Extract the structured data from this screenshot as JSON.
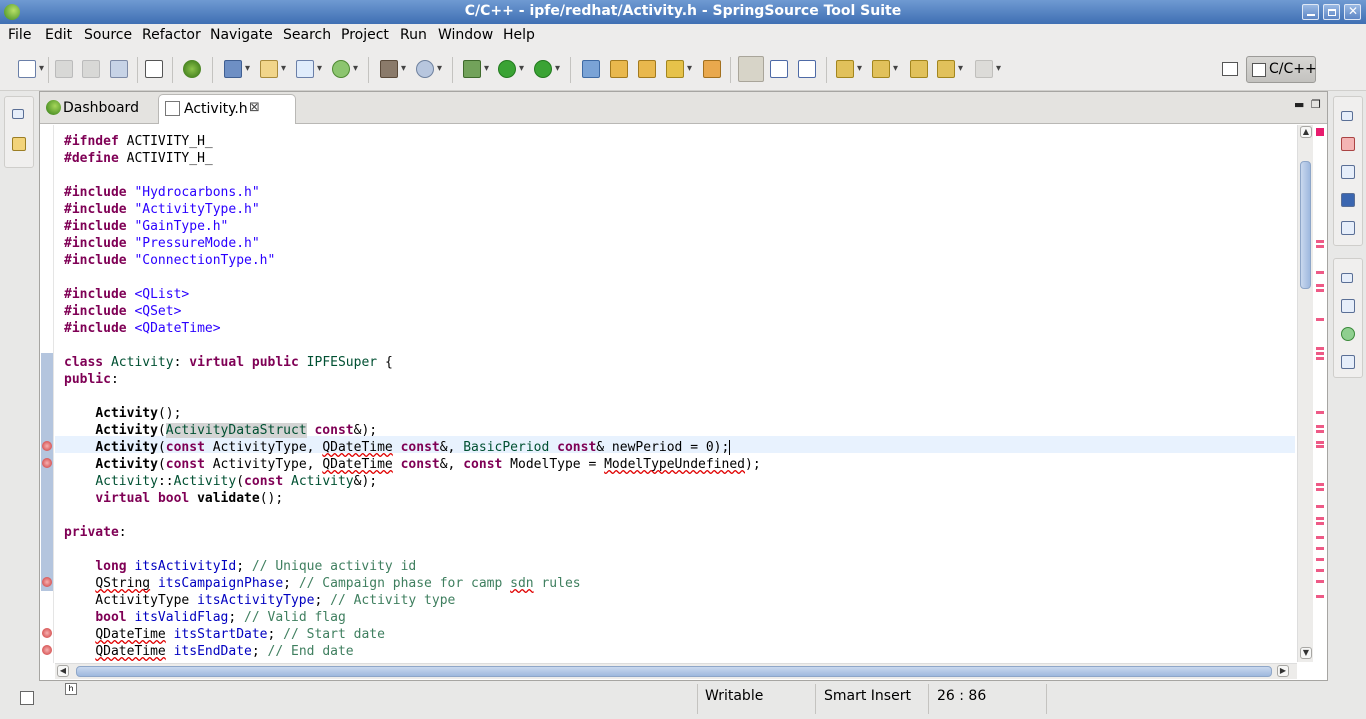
{
  "window": {
    "title": "C/C++ - ipfe/redhat/Activity.h - SpringSource Tool Suite"
  },
  "menu": [
    "File",
    "Edit",
    "Source",
    "Refactor",
    "Navigate",
    "Search",
    "Project",
    "Run",
    "Window",
    "Help"
  ],
  "perspective": {
    "label": "C/C++"
  },
  "tabs": [
    {
      "label": "Dashboard",
      "icon": "dashboard-icon",
      "active": false
    },
    {
      "label": "Activity.h",
      "icon": "header-file-icon",
      "active": true,
      "close": "⊠"
    }
  ],
  "code_lines": [
    "#ifndef ACTIVITY_H_",
    "#define ACTIVITY_H_",
    "",
    "#include \"Hydrocarbons.h\"",
    "#include \"ActivityType.h\"",
    "#include \"GainType.h\"",
    "#include \"PressureMode.h\"",
    "#include \"ConnectionType.h\"",
    "",
    "#include <QList>",
    "#include <QSet>",
    "#include <QDateTime>",
    "",
    "class Activity: virtual public IPFESuper {",
    "public:",
    "",
    "    Activity();",
    "    Activity(ActivityDataStruct const&);",
    "    Activity(const ActivityType, QDateTime const&, BasicPeriod const& newPeriod = 0);",
    "    Activity(const ActivityType, QDateTime const&, const ModelType = ModelTypeUndefined);",
    "    Activity::Activity(const Activity&);",
    "    virtual bool validate();",
    "",
    "private:",
    "",
    "    long itsActivityId; // Unique activity id",
    "    QString itsCampaignPhase; // Campaign phase for camp sdn rules",
    "    ActivityType itsActivityType; // Activity type",
    "    bool itsValidFlag; // Valid flag",
    "    QDateTime itsStartDate; // Start date",
    "    QDateTime itsEndDate; // End date"
  ],
  "status": {
    "writable": "Writable",
    "insert_mode": "Smart Insert",
    "position": "26 : 86"
  },
  "colors": {
    "keyword": "#7f0055",
    "string": "#2a00ff",
    "comment": "#3f7f5f",
    "type": "#005032",
    "field": "#0000c0",
    "title_bar": "#4f7cbf"
  }
}
